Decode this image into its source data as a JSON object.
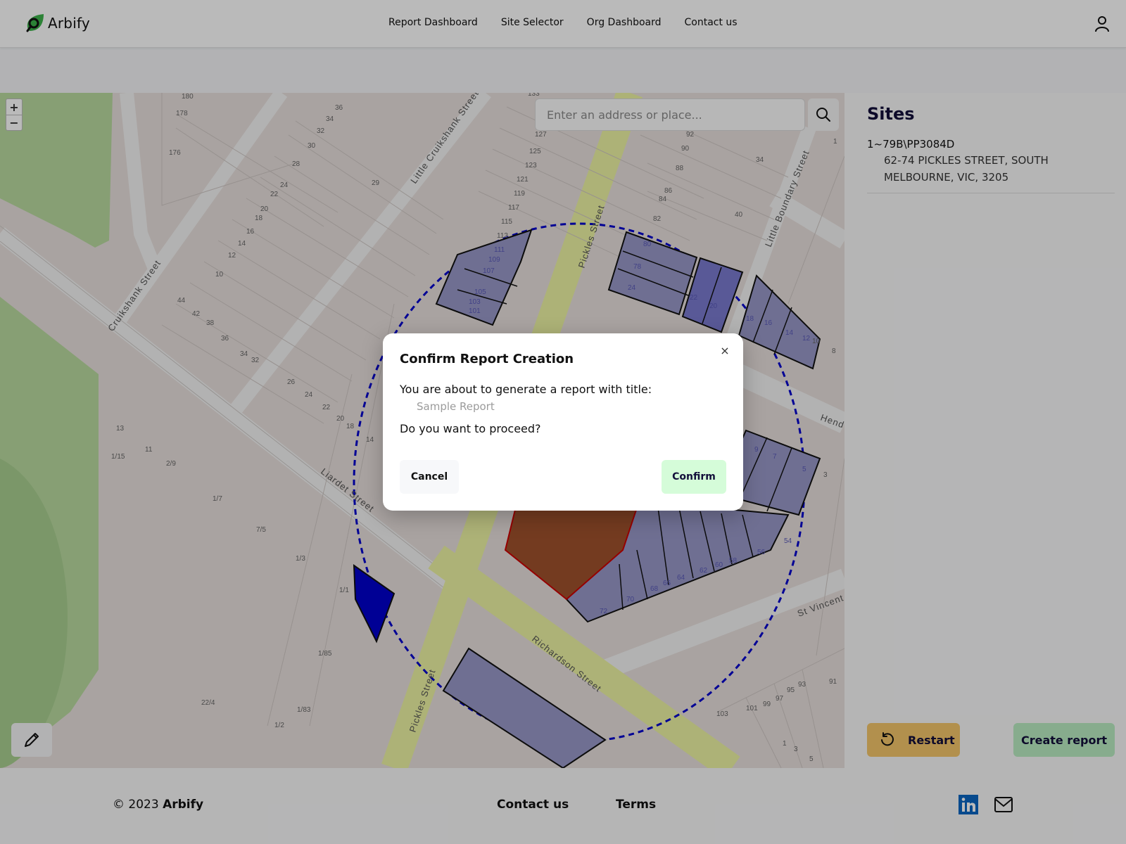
{
  "header": {
    "brand": "Arbify",
    "nav": [
      {
        "label": "Report Dashboard"
      },
      {
        "label": "Site Selector"
      },
      {
        "label": "Org Dashboard"
      },
      {
        "label": "Contact us"
      }
    ],
    "user_icon": "user-icon"
  },
  "map": {
    "search_placeholder": "Enter an address or place...",
    "search_value": "",
    "zoom_in": "+",
    "zoom_out": "−",
    "streets": [
      "Pickles Street",
      "Little Cruikshank Street",
      "Cruikshank Street",
      "Little Boundary Street",
      "Liardet Street",
      "Richardson Street",
      "St Vincent",
      "Hend"
    ],
    "lot_numbers": [
      "180",
      "178",
      "176",
      "36",
      "34",
      "32",
      "30",
      "28",
      "29",
      "24",
      "22",
      "20",
      "18",
      "16",
      "14",
      "12",
      "10",
      "44",
      "42",
      "38",
      "36",
      "34",
      "32",
      "26",
      "24",
      "22",
      "20",
      "18",
      "14",
      "13",
      "11",
      "1/15",
      "2/9",
      "1/7",
      "7/5",
      "1/3",
      "1/1",
      "1/85",
      "22/4",
      "1/83",
      "1/2",
      "133",
      "127",
      "125",
      "123",
      "121",
      "119",
      "117",
      "115",
      "113",
      "111",
      "109",
      "107",
      "105",
      "103",
      "101",
      "92",
      "90",
      "88",
      "86",
      "84",
      "82",
      "40",
      "34",
      "1",
      "80",
      "78",
      "24",
      "22",
      "20",
      "18",
      "16",
      "14",
      "12",
      "10",
      "8",
      "9",
      "7",
      "5",
      "3",
      "72",
      "70",
      "68",
      "66",
      "64",
      "62",
      "60",
      "58",
      "56",
      "54",
      "103",
      "101",
      "99",
      "97",
      "95",
      "93",
      "91",
      "1",
      "3",
      "5"
    ],
    "colors": {
      "selected_parcel": "#a0522d",
      "highlight_parcel": "#9898c8",
      "highlight_parcel_dark": "#7a7ad0",
      "focus_parcel": "#0000cc",
      "radius_line": "#0000cc",
      "main_road": "#eef4a4",
      "minor_road": "#f5f5f5",
      "park": "#b9dba0",
      "land": "#e8e0dd"
    }
  },
  "sidebar": {
    "title": "Sites",
    "sites": [
      {
        "id": "1~79B\\PP3084D",
        "address": "62-74 PICKLES STREET, SOUTH MELBOURNE, VIC, 3205"
      }
    ],
    "restart_label": "Restart",
    "create_report_label": "Create report"
  },
  "footer": {
    "copyright_prefix": "© 2023",
    "copyright_brand": "Arbify",
    "links": [
      {
        "label": "Contact us"
      },
      {
        "label": "Terms"
      }
    ]
  },
  "modal": {
    "title": "Confirm Report Creation",
    "line1": "You are about to generate a report with title:",
    "report_title": "Sample Report",
    "line2": "Do you want to proceed?",
    "cancel_label": "Cancel",
    "confirm_label": "Confirm",
    "close_icon": "×"
  }
}
